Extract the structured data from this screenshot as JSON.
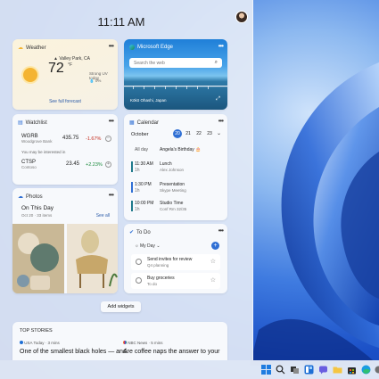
{
  "clock": "11:11 AM",
  "weather": {
    "header": "Weather",
    "location": "Valley Park, CA",
    "temperature": "72",
    "unit": "°F",
    "condition": "Strong UV today",
    "precip": "0%",
    "link": "See full forecast",
    "icon": "sun-icon"
  },
  "edge": {
    "header": "Microsoft Edge",
    "search_placeholder": "Search the web",
    "caption": "Kōkō Ohashi, Japan"
  },
  "watchlist": {
    "header": "Watchlist",
    "stocks": [
      {
        "symbol": "WGRB",
        "name": "Woodgrove Bank",
        "price": "435.75",
        "change": "-1.67%"
      },
      {
        "symbol": "CTSP",
        "name": "Contoso",
        "price": "23.45",
        "change": "+2.23%"
      }
    ],
    "suggestion": "You may be interested in"
  },
  "calendar": {
    "header": "Calendar",
    "month": "October",
    "days": [
      "20",
      "21",
      "22",
      "23"
    ],
    "all_day_label": "All day",
    "all_day_event": "Angela's Birthday",
    "events": [
      {
        "time": "11:30 AM",
        "duration": "1h",
        "title": "Lunch",
        "detail": "Alex  Johnson"
      },
      {
        "time": "1:30 PM",
        "duration": "1h",
        "title": "Presentation",
        "detail": "Skype Meeting"
      },
      {
        "time": "10:00 PM",
        "duration": "1h",
        "title": "Studio Time",
        "detail": "Conf Rm 32/35"
      }
    ]
  },
  "photos": {
    "header": "Photos",
    "title": "On This Day",
    "date": "Oct 20 · 33 items",
    "see_all": "See all"
  },
  "todo": {
    "header": "To Do",
    "list_name": "My Day",
    "tasks": [
      {
        "title": "Send invites for review",
        "list": "Q4 planning"
      },
      {
        "title": "Buy groceries",
        "list": "To do"
      }
    ]
  },
  "add_widgets": "Add widgets",
  "stories": {
    "header": "TOP STORIES",
    "items": [
      {
        "source": "USA Today · 3 mins",
        "title": "One of the smallest black holes — and"
      },
      {
        "source": "NBC News · 5 mins",
        "title": "Are coffee naps the answer to your"
      }
    ]
  },
  "taskbar": [
    "windows-start-icon",
    "search-icon",
    "task-view-icon",
    "widgets-icon",
    "chat-icon",
    "file-explorer-icon",
    "store-icon",
    "edge-icon",
    "settings-icon"
  ]
}
